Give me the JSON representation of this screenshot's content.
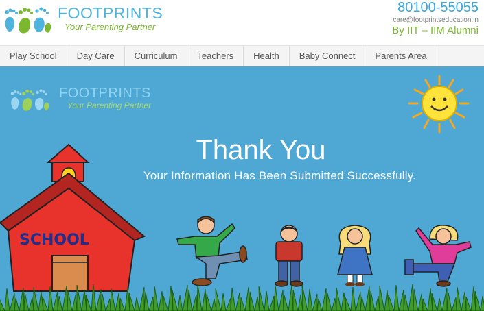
{
  "header": {
    "logo_title": "FOOTPRINTS",
    "logo_tagline": "Your Parenting Partner",
    "phone": "80100-55055",
    "email": "care@footprintseducation.in",
    "alumni": "By IIT – IIM Alumni"
  },
  "nav": {
    "items": [
      "Play School",
      "Day Care",
      "Curriculum",
      "Teachers",
      "Health",
      "Baby Connect",
      "Parents Area"
    ]
  },
  "banner": {
    "logo_title": "FOOTPRINTS",
    "logo_tagline": "Your Parenting Partner",
    "headline": "Thank You",
    "message": "Your Information Has Been Submitted Successfully.",
    "school_sign": "SCHOOL"
  },
  "colors": {
    "banner_bg": "#4fa7d4",
    "brand_blue": "#4eb3dd",
    "brand_green": "#7cb82f",
    "sun": "#ffe33a",
    "school_red": "#e8332c",
    "grass": "#3f9b2a"
  },
  "icons": [
    "footprints-logo-icon",
    "sun-icon",
    "school-house-icon",
    "school-bell-icon",
    "school-door-icon",
    "grass-icon"
  ]
}
